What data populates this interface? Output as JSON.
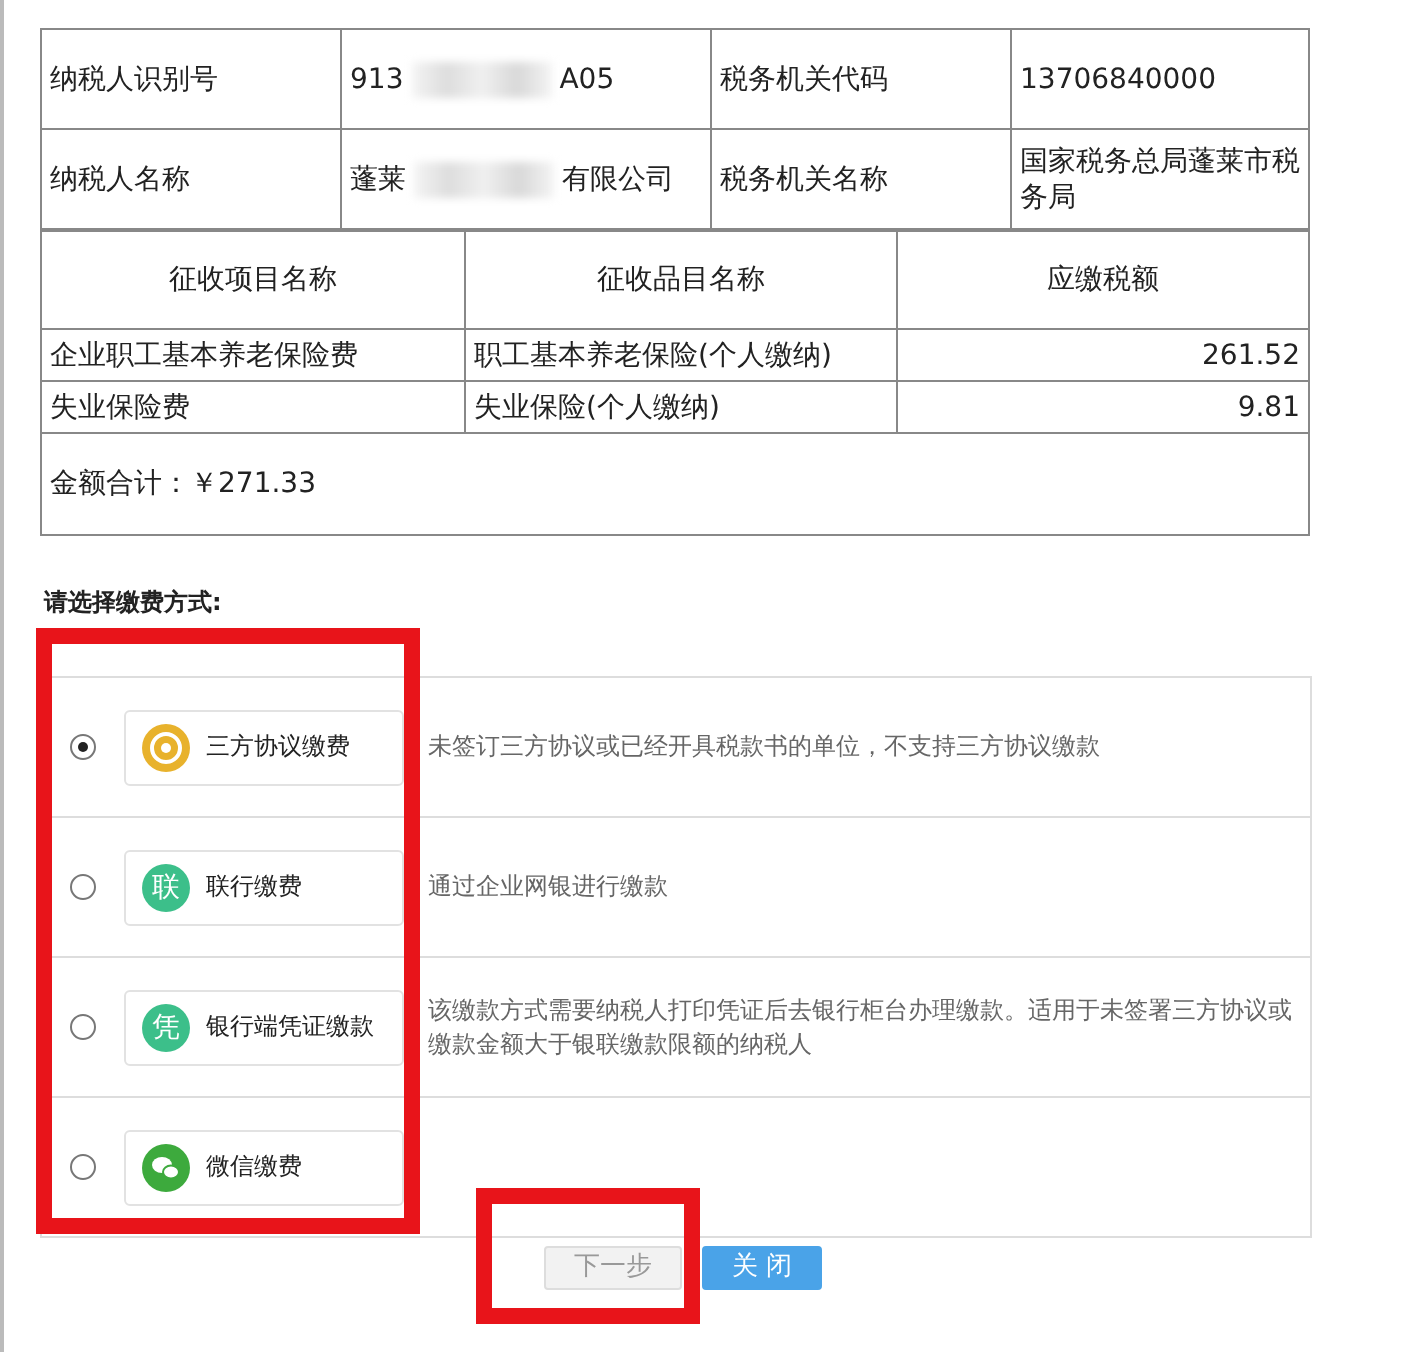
{
  "taxpayer_info": [
    {
      "label": "纳税人识别号",
      "value_start": "913",
      "value_end": "A05",
      "value_redacted": true,
      "office_label": "税务机关代码",
      "office_value": "13706840000"
    },
    {
      "label": "纳税人名称",
      "value_start": "蓬莱",
      "value_end": "有限公司",
      "value_redacted": true,
      "office_label": "税务机关名称",
      "office_value": "国家税务总局蓬莱市税务局"
    }
  ],
  "tax_table": {
    "columns": [
      "征收项目名称",
      "征收品目名称",
      "应缴税额"
    ],
    "rows": [
      [
        "企业职工基本养老保险费",
        "职工基本养老保险(个人缴纳)",
        "261.52"
      ],
      [
        "失业保险费",
        "失业保险(个人缴纳)",
        "9.81"
      ]
    ],
    "total": "金额合计：￥271.33"
  },
  "payment_prompt": "请选择缴费方式:",
  "payment_methods": [
    {
      "label": "三方协议缴费",
      "description": "未签订三方协议或已经开具税款书的单位，不支持三方协议缴款",
      "selected": true,
      "kind": "coin",
      "color": "#e8b22c"
    },
    {
      "label": "联行缴费",
      "description": "通过企业网银进行缴款",
      "selected": false,
      "kind": "glyph",
      "glyph": "联",
      "color": "#3cbf8a"
    },
    {
      "label": "银行端凭证缴款",
      "description": "该缴款方式需要纳税人打印凭证后去银行柜台办理缴款。适用于未签署三方协议或缴款金额大于银联缴款限额的纳税人",
      "selected": false,
      "kind": "glyph",
      "glyph": "凭",
      "color": "#3cbf8a"
    },
    {
      "label": "微信缴费",
      "selected": false,
      "kind": "wechat",
      "color": "#3daa3d"
    }
  ],
  "buttons": [
    {
      "label": "下一步",
      "disabled": true
    },
    {
      "label": "关 闭",
      "disabled": false
    }
  ]
}
